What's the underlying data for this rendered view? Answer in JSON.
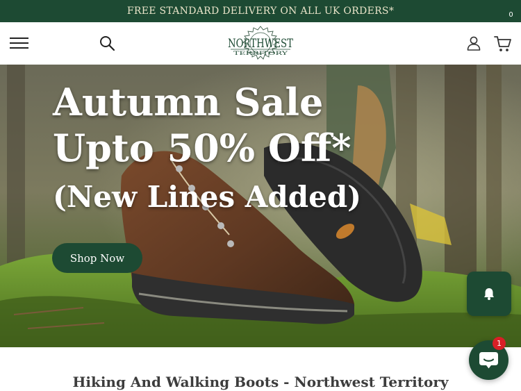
{
  "promo_bar": {
    "text": "FREE STANDARD DELIVERY ON ALL UK ORDERS*"
  },
  "header": {
    "menu_icon": "hamburger-menu-icon",
    "search_icon": "search-icon",
    "logo": {
      "line1": "NORTHWEST",
      "line2": "TERRITORY"
    },
    "account_icon": "user-icon",
    "cart_icon": "cart-icon",
    "cart_count": "0"
  },
  "hero": {
    "line1": "Autumn Sale",
    "line2": "Upto 50% Off*",
    "line3": "(New Lines Added)",
    "button": "Shop Now"
  },
  "notification_icon": "bell-icon",
  "section_title": "Hiking And Walking Boots - Northwest Territory",
  "chat": {
    "icon": "chat-bubble-icon",
    "badge": "1"
  },
  "colors": {
    "brand_green": "#1d4a33",
    "promo_text": "#e9e4c9",
    "badge_red": "#d81f26"
  }
}
